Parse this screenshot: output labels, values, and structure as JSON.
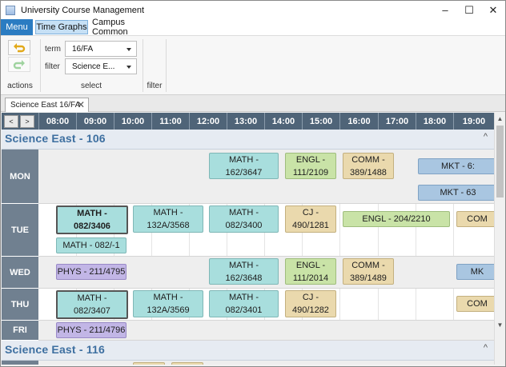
{
  "window": {
    "title": "University Course Management"
  },
  "menu": {
    "label": "Menu"
  },
  "ribbon_tabs": [
    {
      "label": "Time Graphs"
    },
    {
      "label": "Campus Common"
    }
  ],
  "ribbon": {
    "groups": {
      "actions": "actions",
      "select": "select",
      "filter": "filter"
    },
    "term_label": "term",
    "term_value": "16/FA",
    "filter_label": "filter",
    "filter_value": "Science E..."
  },
  "doc_tab": {
    "label": "Science East 16/FA"
  },
  "timeline": {
    "prev": "<",
    "next": ">",
    "hours": [
      "08:00",
      "09:00",
      "10:00",
      "11:00",
      "12:00",
      "13:00",
      "14:00",
      "15:00",
      "16:00",
      "17:00",
      "18:00",
      "19:00"
    ]
  },
  "sections": [
    {
      "title": "Science East - 106"
    },
    {
      "title": "Science East - 116"
    }
  ],
  "days": {
    "mon": "MON",
    "tue": "TUE",
    "wed": "WED",
    "thu": "THU",
    "fri": "FRI"
  },
  "events": {
    "mon_math": "MATH -\n162/3647",
    "mon_engl": "ENGL -\n111/2109",
    "mon_comm": "COMM -\n389/1488",
    "mon_mkt1": "MKT - 6:",
    "mon_mkt2": "MKT - 63",
    "tue_math1": "MATH -\n082/3406",
    "tue_math2": "MATH -\n132A/3568",
    "tue_math3": "MATH -\n082/3400",
    "tue_cj": "CJ -\n490/1281",
    "tue_engl": "ENGL - 204/2210",
    "tue_comm": "COM",
    "tue_math4": "MATH - 082/-1",
    "wed_phys": "PHYS - 211/4795",
    "wed_math": "MATH -\n162/3648",
    "wed_engl": "ENGL -\n111/2014",
    "wed_comm": "COMM -\n389/1489",
    "wed_mk": "MK",
    "thu_math1": "MATH -\n082/3407",
    "thu_math2": "MATH -\n132A/3569",
    "thu_math3": "MATH -\n082/3401",
    "thu_cj": "CJ -\n490/1282",
    "thu_com": "COM",
    "fri_phys": "PHYS - 211/4796"
  },
  "icons": {
    "undo": "undo-icon",
    "redo": "redo-icon",
    "close": "close-icon",
    "dropdown": "chevron-down-icon",
    "collapse": "chevron-up-icon"
  },
  "colors": {
    "menu": "#2b7cc2",
    "header": "#4f6478",
    "day_label": "#708090",
    "section_title": "#3d6fa0",
    "teal": "#a8dedd",
    "green": "#c9e3a7",
    "tan": "#ead9ad",
    "blue": "#a9c6e1",
    "purple": "#c2b6e6"
  }
}
